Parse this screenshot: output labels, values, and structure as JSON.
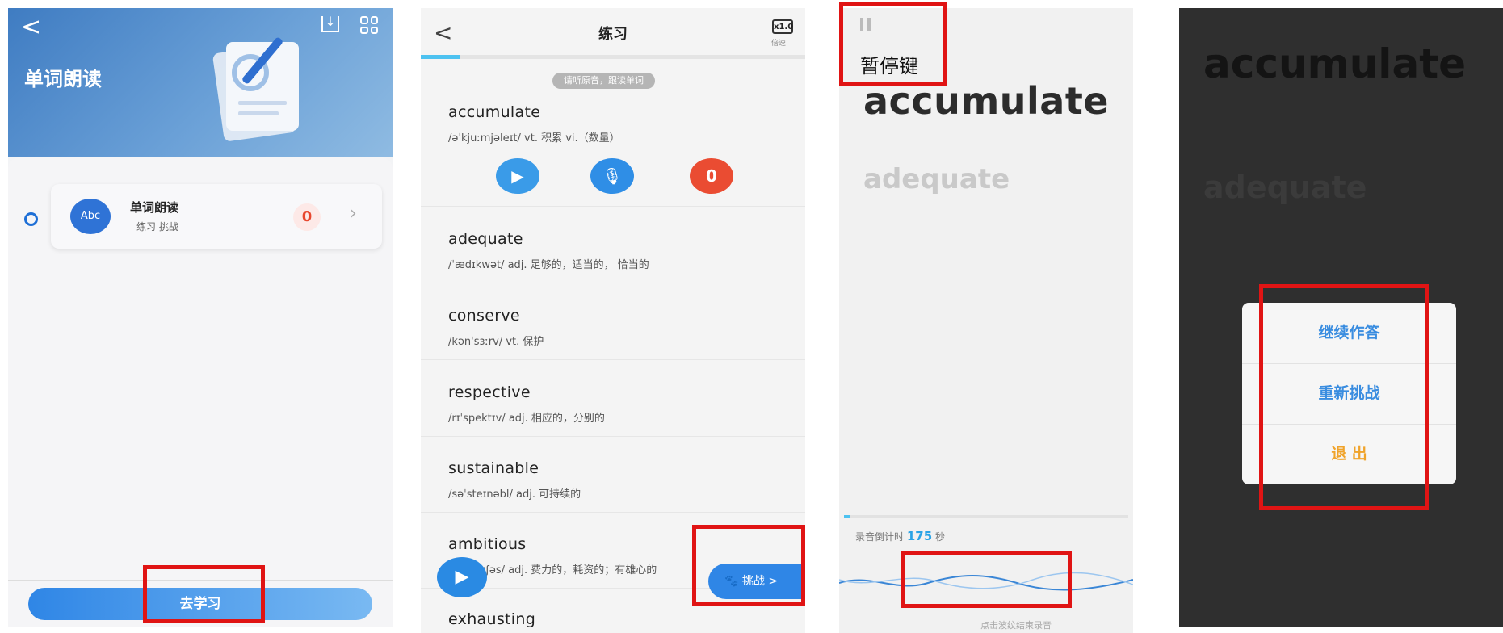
{
  "panel1": {
    "back_icon": "chevron-left",
    "title": "单词朗读",
    "card": {
      "badge": "Abc",
      "title": "单词朗读",
      "subtitle": "练习  挑战",
      "score": "0"
    },
    "go_button": "去学习"
  },
  "panel2": {
    "title": "练习",
    "speed_value": "x1.0",
    "speed_label": "倍速",
    "progress_fraction": 0.1,
    "hint": "请听原音，跟读单词",
    "score": "0",
    "words": [
      {
        "word": "accumulate",
        "def": "/əˈkjuːmjəleɪt/ vt. 积累 vi.（数量）"
      },
      {
        "word": "adequate",
        "def": "/ˈædɪkwət/ adj. 足够的，适当的，  恰当的"
      },
      {
        "word": "conserve",
        "def": "/kənˈsɜːrv/ vt. 保护"
      },
      {
        "word": "respective",
        "def": "/rɪˈspektɪv/ adj. 相应的，分别的"
      },
      {
        "word": "sustainable",
        "def": "/səˈsteɪnəbl/ adj. 可持续的"
      },
      {
        "word": "ambitious",
        "def": "/æmˈbɪʃəs/ adj. 费力的，耗资的；有雄心的"
      },
      {
        "word": "exhausting",
        "def": ""
      }
    ],
    "challenge_label": "挑战 >"
  },
  "panel3": {
    "pause_label": "暂停键",
    "current_word": "accumulate",
    "next_word": "adequate",
    "countdown_prefix": "录音倒计时",
    "countdown_value": "175",
    "countdown_unit": "秒",
    "progress_fraction": 0.02,
    "end_hint": "点击波纹结束录音"
  },
  "panel4": {
    "current_word": "accumulate",
    "next_word": "adequate",
    "options": [
      "继续作答",
      "重新挑战",
      "退 出"
    ]
  },
  "colors": {
    "accent_blue": "#2f86e6",
    "score_red": "#e8472e",
    "highlight_red": "#e01414",
    "exit_orange": "#f0a32a"
  }
}
